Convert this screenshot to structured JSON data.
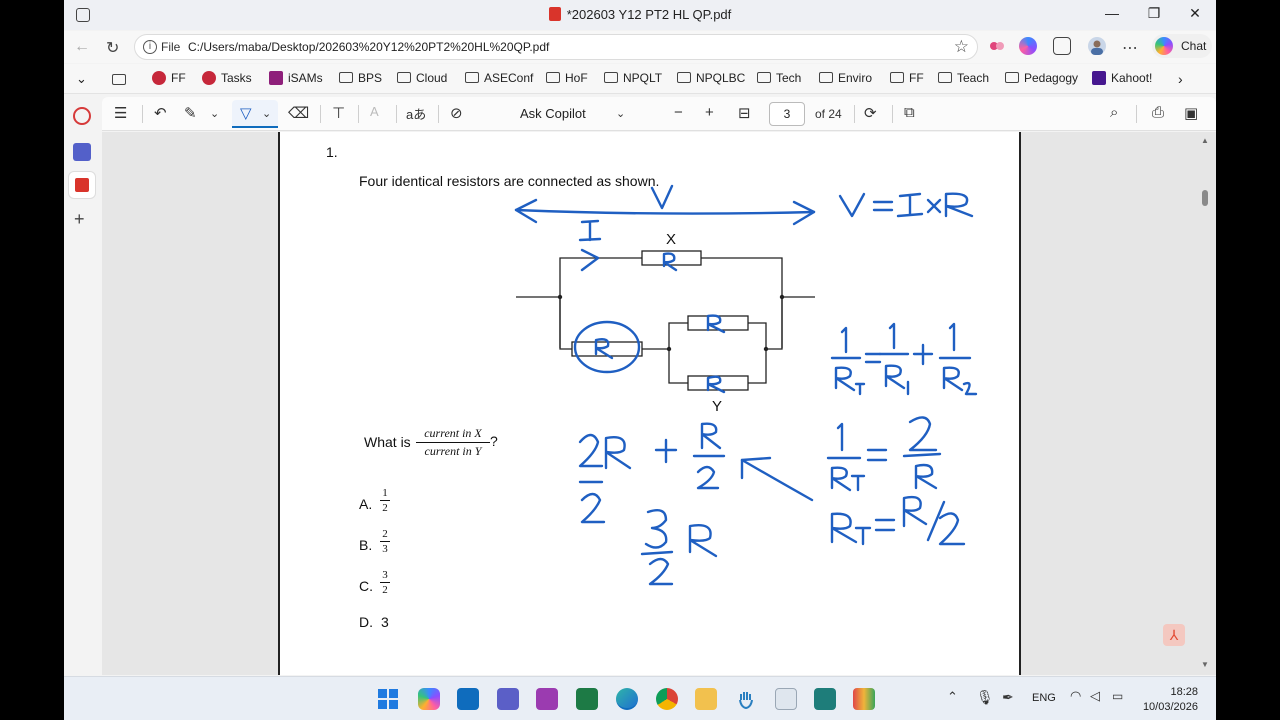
{
  "window": {
    "title": "*202603 Y12 PT2 HL QP.pdf",
    "minimize": "—",
    "maximize": "❐",
    "close": "✕"
  },
  "address": {
    "label": "File",
    "url": "C:/Users/maba/Desktop/202603%20Y12%20PT2%20HL%20QP.pdf"
  },
  "chat_label": "Chat",
  "favorites": [
    "FF",
    "Tasks",
    "iSAMs",
    "BPS",
    "Cloud",
    "ASEConf",
    "HoF",
    "NPQLT",
    "NPQLBC",
    "Tech",
    "Enviro",
    "FF",
    "Teach",
    "Pedagogy",
    "Kahoot!"
  ],
  "pdf_toolbar": {
    "ask_copilot": "Ask Copilot",
    "page_current": "3",
    "page_of": "of 24",
    "zoom_out": "−",
    "zoom_in": "+"
  },
  "question": {
    "number": "1.",
    "intro": "Four identical resistors are connected as shown.",
    "label_x": "X",
    "label_y": "Y",
    "prompt_prefix": "What is",
    "prompt_num": "current in X",
    "prompt_den": "current in Y",
    "prompt_suffix": "?",
    "options": [
      {
        "letter": "A.",
        "num": "1",
        "den": "2"
      },
      {
        "letter": "B.",
        "num": "2",
        "den": "3"
      },
      {
        "letter": "C.",
        "num": "3",
        "den": "2"
      },
      {
        "letter": "D.",
        "value": "3"
      }
    ]
  },
  "ink_color": "#1f5fc2",
  "taskbar": {
    "language": "ENG",
    "time": "18:28",
    "date": "10/03/2026"
  }
}
